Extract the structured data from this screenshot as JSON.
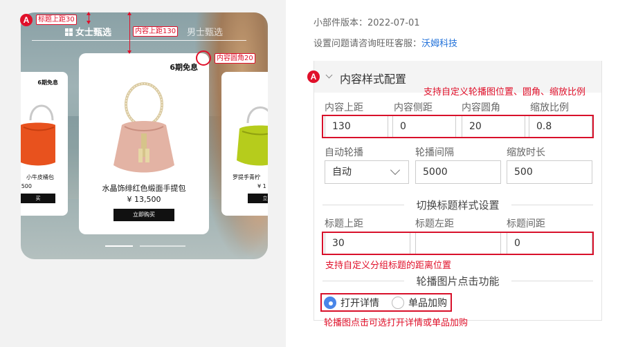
{
  "preview": {
    "nav": {
      "active_tab": "女士甄选",
      "inactive_tab": "男士甄选"
    },
    "main_card": {
      "badge": "6期免息",
      "name": "水晶饰绯红色缎面手提包",
      "price": "¥ 13,500",
      "buy_label": "立即购买"
    },
    "left_card": {
      "badge": "6期免息",
      "name": "小牛皮桶包",
      "price": "500",
      "buy_label": "买"
    },
    "right_card": {
      "name": "罗提手青柠",
      "price": "¥ 1",
      "buy_label": "立"
    },
    "annotations": {
      "badge": "A",
      "title_top": "标题上距30",
      "content_top": "内容上距130",
      "content_radius": "内容圆角20"
    }
  },
  "info": {
    "version_label": "小部件版本：2022-07-01",
    "contact_label": "设置问题请咨询旺旺客服：",
    "contact_link": "沃姆科技"
  },
  "panel": {
    "badge": "A",
    "title": "内容样式配置",
    "note_carousel": "支持自定义轮播图位置、圆角、缩放比例",
    "row1": {
      "labels": [
        "内容上距",
        "内容侧距",
        "内容圆角",
        "缩放比例"
      ],
      "values": [
        "130",
        "0",
        "20",
        "0.8"
      ]
    },
    "row2": {
      "labels": [
        "自动轮播",
        "轮播间隔",
        "缩放时长"
      ],
      "values": [
        "自动",
        "5000",
        "500"
      ]
    },
    "section_title_style": "切换标题样式设置",
    "row3": {
      "labels": [
        "标题上距",
        "标题左距",
        "标题间距"
      ],
      "values": [
        "30",
        "",
        "0"
      ]
    },
    "note_title": "支持自定义分组标题的距离位置",
    "section_click": "轮播图片点击功能",
    "radio": {
      "option_details": "打开详情",
      "option_add": "单品加购",
      "selected": "打开详情"
    },
    "note_click": "轮播图点击可选打开详情或单品加购"
  },
  "colors": {
    "accent_red": "#e0102a",
    "link_blue": "#1e6fd9",
    "radio_blue": "#4a86e8"
  }
}
